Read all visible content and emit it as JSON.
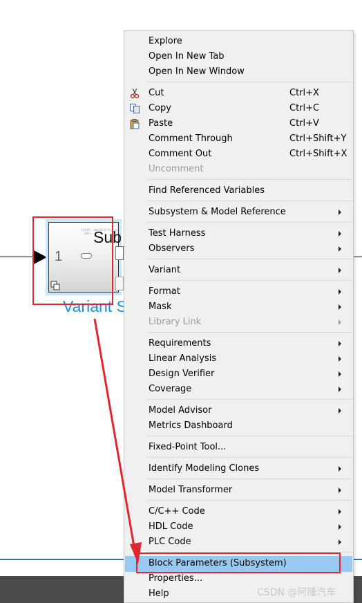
{
  "canvas": {
    "block": {
      "title": "Sub",
      "port_number": "1",
      "name_label": "Variant S",
      "tiny_text": "1) Edit ... blocks 2) Viv... to ... dele...",
      "badge_icon": "copy-icon"
    }
  },
  "context_menu": {
    "groups": [
      [
        {
          "label": "Explore"
        },
        {
          "label": "Open In New Tab"
        },
        {
          "label": "Open In New Window"
        }
      ],
      [
        {
          "label": "Cut",
          "shortcut": "Ctrl+X",
          "icon": "scissors-icon"
        },
        {
          "label": "Copy",
          "shortcut": "Ctrl+C",
          "icon": "copy-icon"
        },
        {
          "label": "Paste",
          "shortcut": "Ctrl+V",
          "icon": "paste-icon"
        },
        {
          "label": "Comment Through",
          "shortcut": "Ctrl+Shift+Y"
        },
        {
          "label": "Comment Out",
          "shortcut": "Ctrl+Shift+X"
        },
        {
          "label": "Uncomment",
          "disabled": true
        }
      ],
      [
        {
          "label": "Find Referenced Variables"
        }
      ],
      [
        {
          "label": "Subsystem & Model Reference",
          "submenu": true
        }
      ],
      [
        {
          "label": "Test Harness",
          "submenu": true
        },
        {
          "label": "Observers",
          "submenu": true
        }
      ],
      [
        {
          "label": "Variant",
          "submenu": true
        }
      ],
      [
        {
          "label": "Format",
          "submenu": true
        },
        {
          "label": "Mask",
          "submenu": true
        },
        {
          "label": "Library Link",
          "submenu": true,
          "disabled": true
        }
      ],
      [
        {
          "label": "Requirements",
          "submenu": true
        },
        {
          "label": "Linear Analysis",
          "submenu": true
        },
        {
          "label": "Design Verifier",
          "submenu": true
        },
        {
          "label": "Coverage",
          "submenu": true
        }
      ],
      [
        {
          "label": "Model Advisor",
          "submenu": true
        },
        {
          "label": "Metrics Dashboard"
        }
      ],
      [
        {
          "label": "Fixed-Point Tool..."
        }
      ],
      [
        {
          "label": "Identify Modeling Clones",
          "submenu": true
        }
      ],
      [
        {
          "label": "Model Transformer",
          "submenu": true
        }
      ],
      [
        {
          "label": "C/C++ Code",
          "submenu": true
        },
        {
          "label": "HDL Code",
          "submenu": true
        },
        {
          "label": "PLC Code",
          "submenu": true
        }
      ],
      [
        {
          "label": "Block Parameters (Subsystem)",
          "selected": true
        },
        {
          "label": "Properties..."
        },
        {
          "label": "Help"
        }
      ]
    ]
  },
  "watermark": "CSDN @阿隆汽车",
  "colors": {
    "menu_background": "#f0f0f0",
    "selected_item": "#99c9f1",
    "highlight_red": "#e0262e",
    "block_name_blue": "#1d8fe0"
  }
}
